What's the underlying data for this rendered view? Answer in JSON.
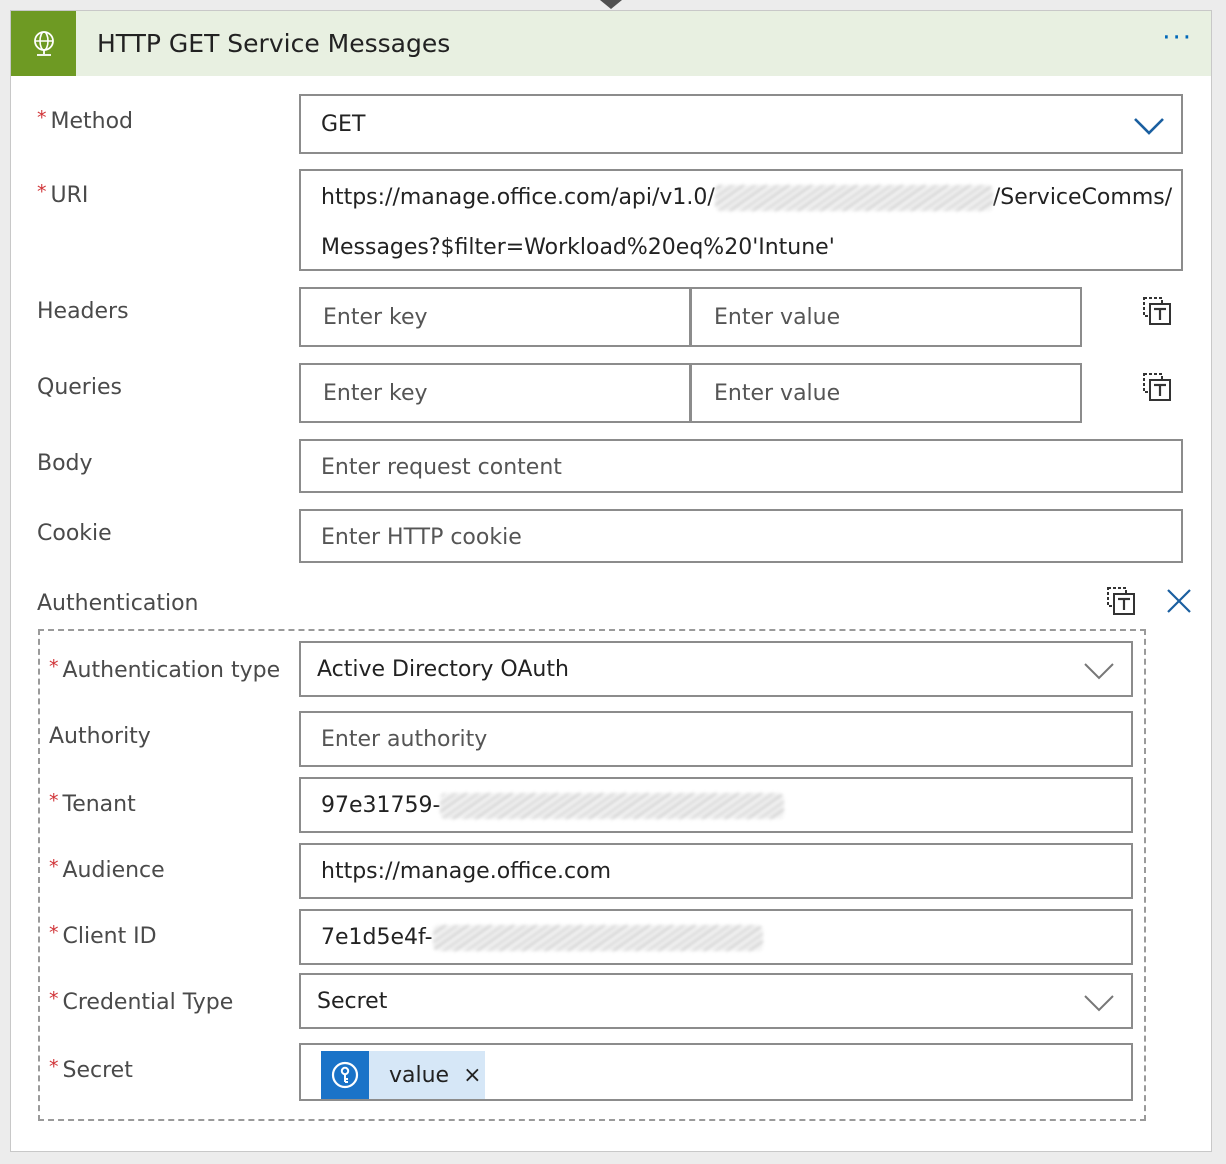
{
  "card": {
    "title": "HTTP GET Service Messages",
    "more_label": "···",
    "header_icon": "globe-icon",
    "accent": "#6e9a23"
  },
  "required_marker": "*",
  "method": {
    "label": "Method",
    "value": "GET"
  },
  "uri": {
    "label": "URI",
    "line1_start": "https://manage.office.com/api/v1.0/",
    "line1_end": "/ServiceComms/",
    "line2": "Messages?$filter=Workload%20eq%20'Intune'"
  },
  "headers": {
    "label": "Headers",
    "key_placeholder": "Enter key",
    "value_placeholder": "Enter value"
  },
  "queries": {
    "label": "Queries",
    "key_placeholder": "Enter key",
    "value_placeholder": "Enter value"
  },
  "body": {
    "label": "Body",
    "placeholder": "Enter request content"
  },
  "cookie": {
    "label": "Cookie",
    "placeholder": "Enter HTTP cookie"
  },
  "authentication": {
    "label": "Authentication",
    "type": {
      "label": "Authentication type",
      "value": "Active Directory OAuth"
    },
    "authority": {
      "label": "Authority",
      "placeholder": "Enter authority"
    },
    "tenant": {
      "label": "Tenant",
      "value": "97e31759-"
    },
    "audience": {
      "label": "Audience",
      "value": "https://manage.office.com"
    },
    "client_id": {
      "label": "Client ID",
      "value": "7e1d5e4f-"
    },
    "credential_type": {
      "label": "Credential Type",
      "value": "Secret"
    },
    "secret": {
      "label": "Secret",
      "token_label": "value",
      "token_remove": "×",
      "token_icon": "key-vault-icon"
    }
  }
}
